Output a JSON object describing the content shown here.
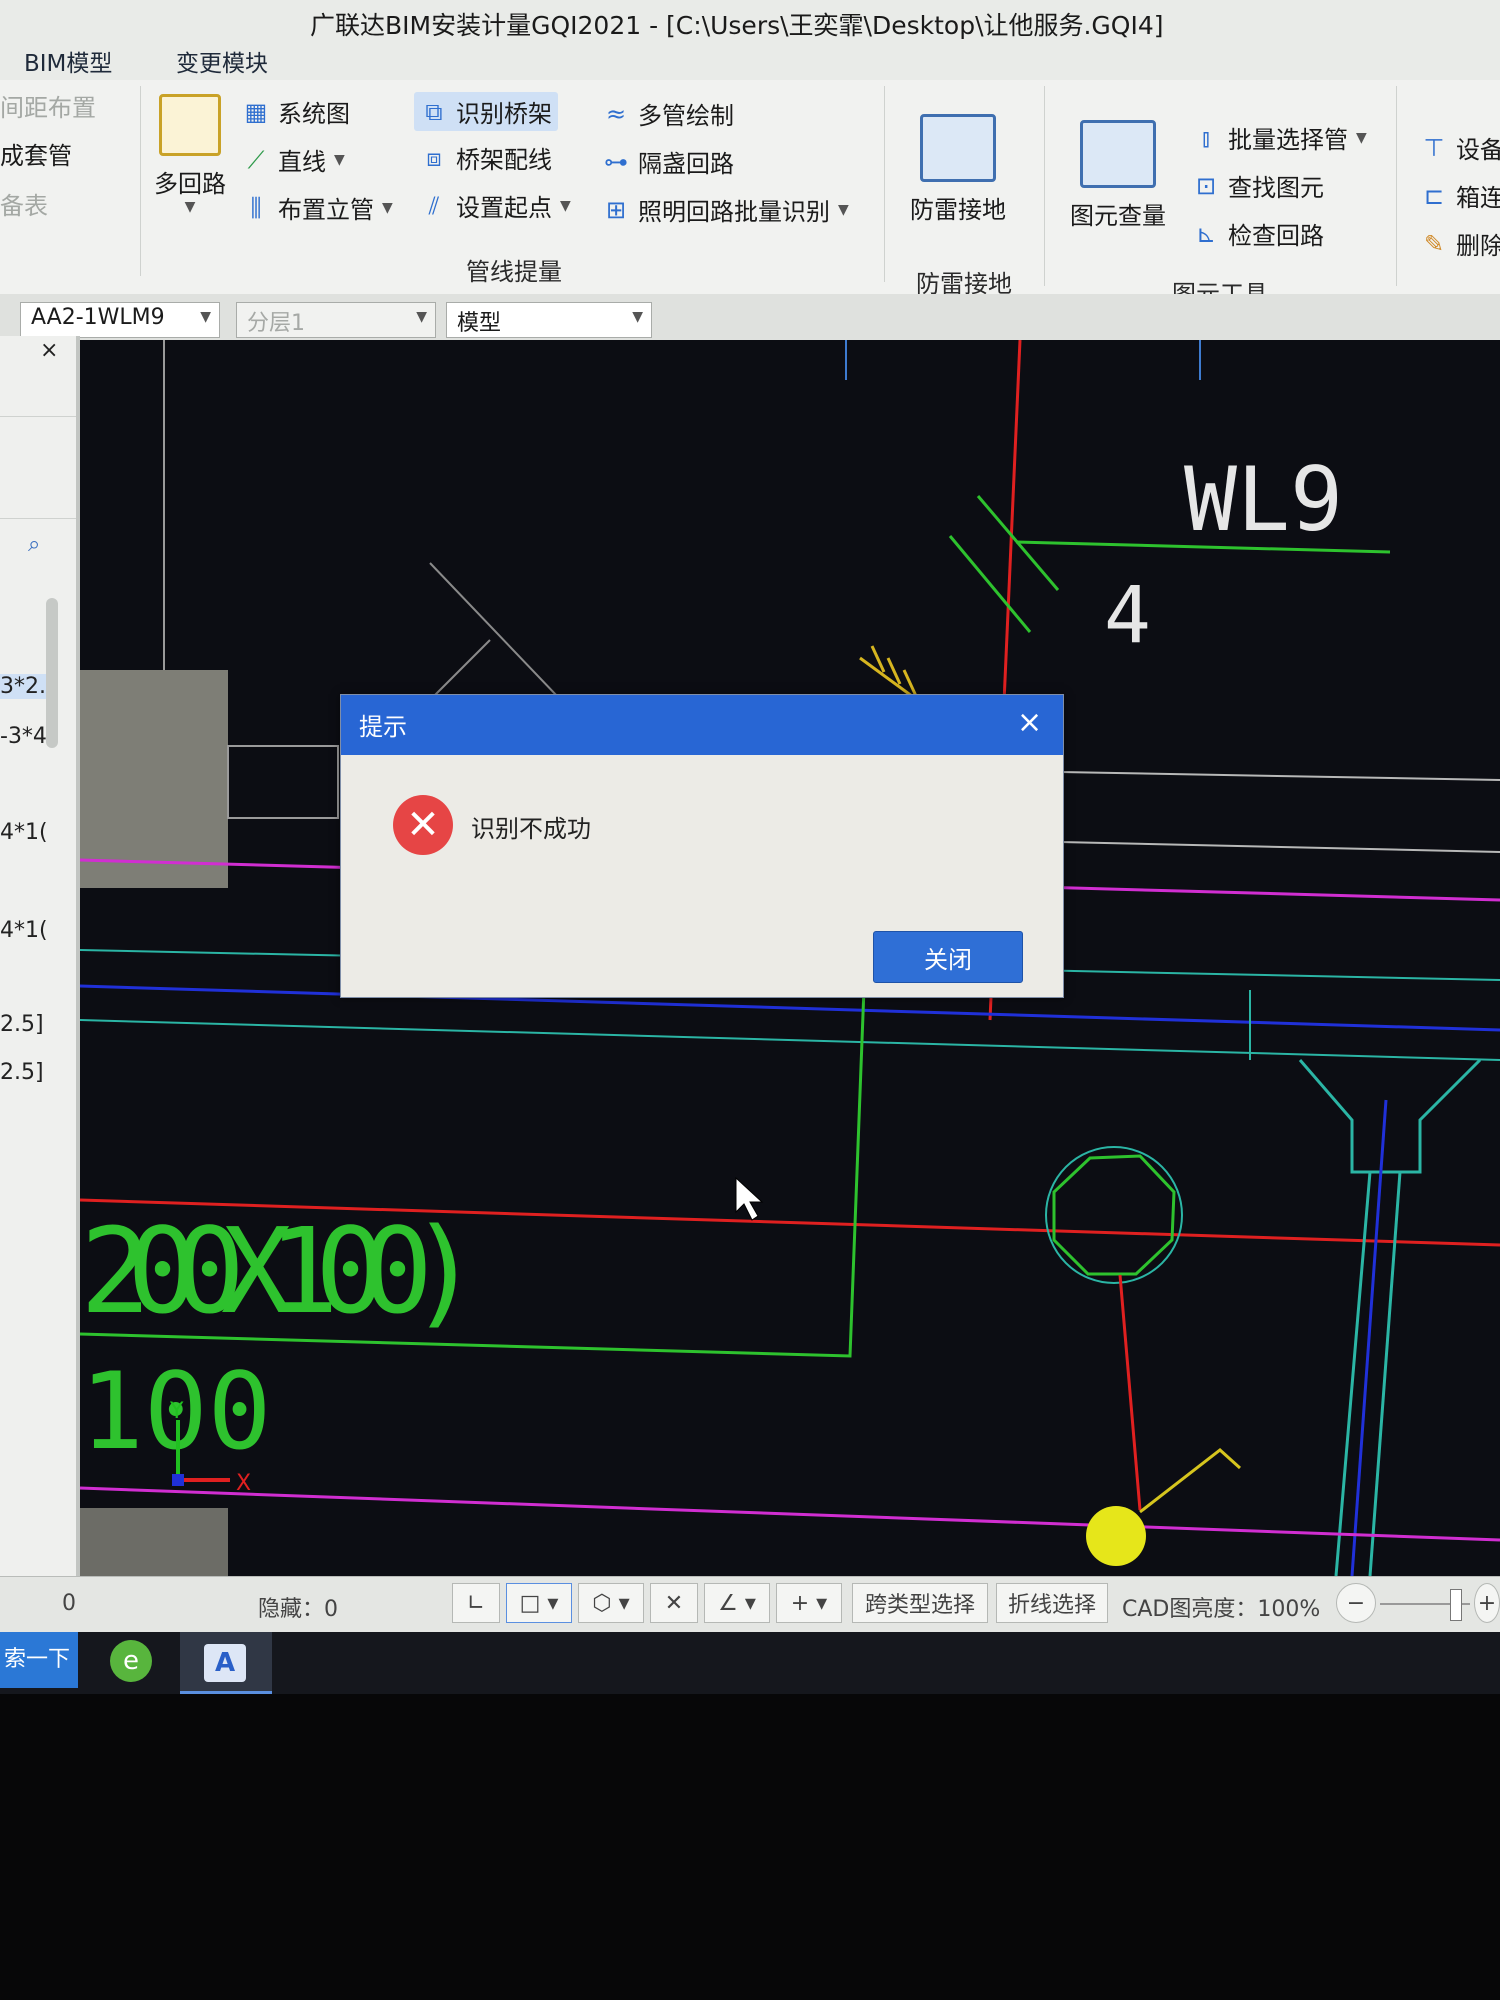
{
  "window": {
    "title": "广联达BIM安装计量GQI2021 - [C:\\Users\\王奕霏\\Desktop\\让他服务.GQI4]"
  },
  "menu": {
    "tabs": [
      "BIM模型",
      "变更模块"
    ]
  },
  "ribbon": {
    "left_partial": [
      "间距布置",
      "成套管",
      "备表"
    ],
    "pipeline_group": {
      "label": "管线提量",
      "multi_loop": "多回路",
      "system_diagram": "系统图",
      "straight_line": "直线",
      "place_riser": "布置立管",
      "identify_bridge": "识别桥架",
      "bridge_wiring": "桥架配线",
      "set_start": "设置起点",
      "multi_pipe_draw": "多管绘制",
      "hidden_loop": "隔盏回路",
      "lighting_batch_identify": "照明回路批量识别"
    },
    "lightning_group": {
      "label": "防雷接地",
      "button": "防雷接地"
    },
    "element_tools_group": {
      "label": "图元工具",
      "element_quantity": "图元查量",
      "batch_select_pipe": "批量选择管",
      "find_element": "查找图元",
      "check_loop": "检查回路"
    },
    "right_partial": [
      "设备",
      "箱连",
      "删除"
    ]
  },
  "dropdowns": {
    "system": "AA2-1WLM9",
    "layer": "分层1",
    "view": "模型"
  },
  "left_panel": {
    "close": "×",
    "items": [
      "3*2.",
      "-3*4",
      "4*1(",
      "4*1(",
      "2.5]",
      "2.5]"
    ]
  },
  "canvas": {
    "label_wl9": "WL9",
    "label_4": "4",
    "label_tray": "200X100)",
    "label_100": "100",
    "axis_y": "Y",
    "axis_x": "X"
  },
  "dialog": {
    "title": "提示",
    "close": "×",
    "message": "识别不成功",
    "button": "关闭"
  },
  "statusbar": {
    "left_value": "0",
    "hidden": "隐藏：0",
    "cross_type_select": "跨类型选择",
    "polyline_select": "折线选择",
    "cad_brightness": "CAD图亮度：100%"
  },
  "taskbar": {
    "search": "索一下"
  },
  "colors": {
    "dialog_header": "#2866d4",
    "error": "#e64545",
    "canvas_bg": "#0c0d13"
  }
}
